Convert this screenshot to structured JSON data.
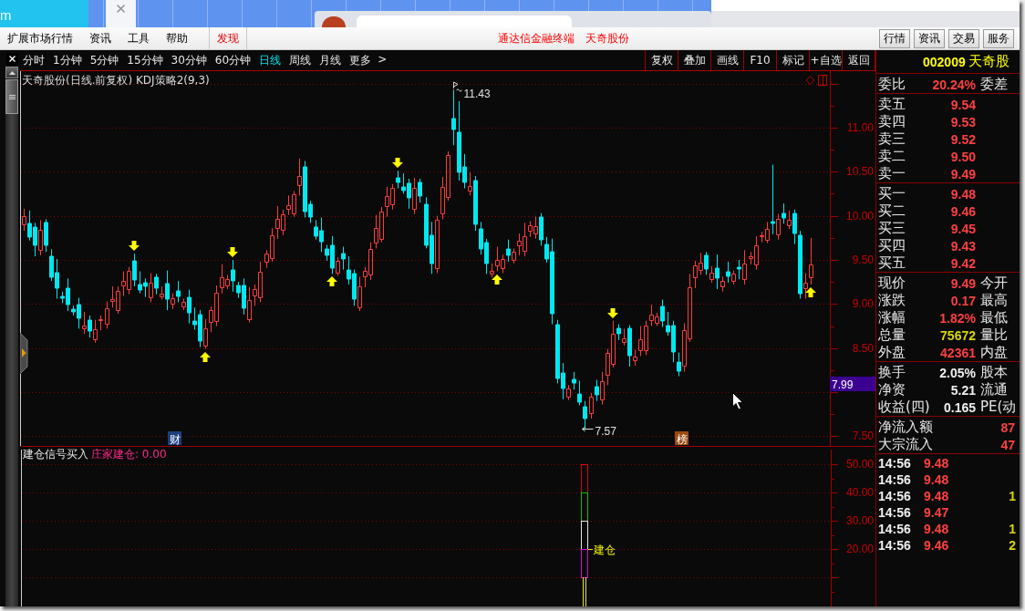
{
  "top_strip": {
    "text": "m"
  },
  "menu_bar": {
    "items": [
      {
        "label": "扩展市场行情",
        "kind": "menu"
      },
      {
        "label": "资讯",
        "kind": "menu"
      },
      {
        "label": "工具",
        "kind": "menu"
      },
      {
        "label": "帮助",
        "kind": "menu"
      },
      {
        "label": "发现",
        "kind": "feature"
      }
    ],
    "titles": [
      "通达信金融终端",
      "天奇股份"
    ],
    "buttons": [
      "行情",
      "资讯",
      "交易",
      "服务"
    ]
  },
  "toolbar": {
    "periods": [
      {
        "label": "分时",
        "selected": false
      },
      {
        "label": "1分钟",
        "selected": false
      },
      {
        "label": "5分钟",
        "selected": false
      },
      {
        "label": "15分钟",
        "selected": false
      },
      {
        "label": "30分钟",
        "selected": false
      },
      {
        "label": "60分钟",
        "selected": false
      },
      {
        "label": "日线",
        "selected": true
      },
      {
        "label": "周线",
        "selected": false
      },
      {
        "label": "月线",
        "selected": false
      }
    ],
    "more": {
      "label": "更多",
      "arrow": ">"
    },
    "tools": [
      "复权",
      "叠加",
      "画线",
      "F10",
      "标记",
      "+自选",
      "返回"
    ]
  },
  "main_chart": {
    "title": "天奇股份(日线.前复权) KDJ策略2(9,3)",
    "high_label": "11.43",
    "low_label": "7.57",
    "price_tag": "7.99",
    "badges": [
      {
        "label": "财",
        "kind": "finance"
      },
      {
        "label": "榜",
        "kind": "ranking"
      }
    ],
    "chart_data": {
      "type": "candlestick",
      "grid": true,
      "ylim": [
        7.38,
        11.64
      ],
      "yticks": [
        {
          "value": 11,
          "label": "11.00"
        },
        {
          "value": 10.5,
          "label": "10.50"
        },
        {
          "value": 10,
          "label": "10.00"
        },
        {
          "value": 9.5,
          "label": "9.50"
        },
        {
          "value": 9,
          "label": "9.00"
        },
        {
          "value": 8.5,
          "label": "8.50"
        },
        {
          "value": 7.5,
          "label": "7.50"
        }
      ],
      "categories": [
        null,
        null,
        null,
        null,
        null,
        null,
        null,
        null,
        null,
        null,
        null,
        null,
        null,
        null,
        null,
        null,
        null,
        null,
        null,
        null,
        null,
        null,
        null,
        null,
        null,
        null,
        null,
        null,
        null,
        null,
        null,
        null,
        null,
        null,
        null,
        null,
        null,
        null,
        null,
        null,
        null,
        null,
        null,
        null,
        null,
        null,
        null,
        null,
        null,
        null,
        null,
        null,
        null,
        null,
        null,
        null,
        null,
        null,
        null,
        null,
        null,
        null,
        null,
        null,
        null,
        null,
        null,
        null,
        null,
        null,
        null,
        null,
        null,
        null,
        null,
        null,
        null,
        null,
        null,
        null,
        null,
        null,
        null,
        null,
        null,
        null,
        null,
        null,
        null,
        null,
        null,
        null,
        null,
        null,
        null,
        null,
        null,
        null,
        null,
        null,
        null,
        null,
        null,
        null,
        null,
        null,
        null,
        null,
        null,
        null,
        null,
        null,
        null,
        null,
        null,
        null,
        null,
        null,
        null,
        null,
        null,
        null,
        null,
        null,
        null,
        null,
        null,
        null,
        null,
        null,
        null,
        null,
        null,
        null,
        null,
        null,
        null,
        null,
        null,
        null,
        null,
        null,
        null,
        null,
        null,
        null,
        null
      ],
      "ohlc": [
        [
          9.9,
          10.08,
          9.83,
          10.0
        ],
        [
          9.91,
          10.06,
          9.72,
          9.76
        ],
        [
          9.87,
          9.92,
          9.54,
          9.66
        ],
        [
          9.61,
          9.95,
          9.55,
          9.84
        ],
        [
          9.92,
          9.96,
          9.59,
          9.66
        ],
        [
          9.54,
          9.62,
          9.26,
          9.3
        ],
        [
          9.36,
          9.51,
          9.06,
          9.18
        ],
        [
          9.09,
          9.14,
          9.01,
          9.07
        ],
        [
          9.18,
          9.29,
          8.92,
          8.99
        ],
        [
          8.94,
          8.98,
          8.87,
          8.91
        ],
        [
          8.99,
          9.07,
          8.72,
          8.84
        ],
        [
          8.72,
          8.91,
          8.66,
          8.76
        ],
        [
          8.82,
          8.87,
          8.62,
          8.69
        ],
        [
          8.6,
          8.82,
          8.56,
          8.71
        ],
        [
          8.82,
          8.87,
          8.7,
          8.83
        ],
        [
          8.78,
          9.03,
          8.72,
          8.95
        ],
        [
          9.03,
          9.2,
          8.96,
          9.05
        ],
        [
          8.93,
          9.2,
          8.89,
          9.15
        ],
        [
          9.21,
          9.37,
          9.09,
          9.26
        ],
        [
          9.17,
          9.42,
          9.11,
          9.38
        ],
        [
          9.49,
          9.57,
          9.2,
          9.27
        ],
        [
          9.22,
          9.37,
          9.12,
          9.16
        ],
        [
          9.24,
          9.29,
          9.08,
          9.2
        ],
        [
          9.08,
          9.35,
          9.02,
          9.24
        ],
        [
          9.3,
          9.34,
          9.11,
          9.18
        ],
        [
          9.09,
          9.2,
          9.05,
          9.12
        ],
        [
          9.23,
          9.38,
          8.93,
          9.05
        ],
        [
          9.0,
          9.12,
          8.94,
          9.07
        ],
        [
          9.15,
          9.26,
          9.02,
          9.09
        ],
        [
          8.97,
          9.06,
          8.93,
          9.02
        ],
        [
          9.08,
          9.16,
          8.78,
          8.9
        ],
        [
          8.81,
          8.96,
          8.71,
          8.77
        ],
        [
          8.88,
          8.93,
          8.51,
          8.58
        ],
        [
          8.53,
          8.83,
          8.49,
          8.72
        ],
        [
          8.8,
          8.97,
          8.68,
          8.93
        ],
        [
          8.81,
          9.21,
          8.75,
          9.13
        ],
        [
          9.19,
          9.45,
          9.12,
          9.3
        ],
        [
          9.21,
          9.33,
          9.17,
          9.28
        ],
        [
          9.39,
          9.5,
          9.14,
          9.26
        ],
        [
          9.21,
          9.25,
          9.07,
          9.13
        ],
        [
          9.21,
          9.29,
          8.88,
          8.95
        ],
        [
          8.83,
          9.19,
          8.79,
          9.04
        ],
        [
          9.1,
          9.22,
          8.98,
          9.17
        ],
        [
          9.08,
          9.48,
          9.02,
          9.37
        ],
        [
          9.48,
          9.61,
          9.41,
          9.57
        ],
        [
          9.52,
          9.86,
          9.48,
          9.78
        ],
        [
          9.86,
          10.11,
          9.74,
          9.96
        ],
        [
          9.84,
          10.07,
          9.78,
          10.02
        ],
        [
          10.08,
          10.23,
          10.01,
          10.12
        ],
        [
          10.03,
          10.28,
          9.99,
          10.24
        ],
        [
          10.35,
          10.65,
          10.23,
          10.45
        ],
        [
          10.55,
          10.62,
          9.98,
          10.05
        ],
        [
          10.13,
          10.17,
          9.92,
          9.99
        ],
        [
          9.87,
          9.95,
          9.73,
          9.77
        ],
        [
          9.83,
          9.98,
          9.59,
          9.71
        ],
        [
          9.62,
          9.67,
          9.49,
          9.55
        ],
        [
          9.66,
          9.77,
          9.34,
          9.41
        ],
        [
          9.36,
          9.53,
          9.32,
          9.49
        ],
        [
          9.57,
          9.65,
          9.39,
          9.51
        ],
        [
          9.39,
          9.54,
          9.22,
          9.28
        ],
        [
          9.34,
          9.39,
          8.98,
          9.05
        ],
        [
          8.96,
          9.31,
          8.92,
          9.2
        ],
        [
          9.31,
          9.42,
          9.19,
          9.38
        ],
        [
          9.33,
          9.7,
          9.27,
          9.62
        ],
        [
          9.7,
          10.01,
          9.63,
          9.86
        ],
        [
          9.74,
          10.1,
          9.7,
          10.05
        ],
        [
          10.11,
          10.33,
          9.99,
          10.22
        ],
        [
          10.13,
          10.36,
          10.07,
          10.32
        ],
        [
          10.43,
          10.51,
          10.31,
          10.38
        ],
        [
          10.33,
          10.48,
          10.25,
          10.29
        ],
        [
          10.37,
          10.42,
          10.08,
          10.2
        ],
        [
          10.08,
          10.43,
          10.02,
          10.32
        ],
        [
          10.38,
          10.42,
          10.15,
          10.22
        ],
        [
          10.13,
          10.21,
          9.63,
          9.67
        ],
        [
          9.78,
          9.93,
          9.34,
          9.46
        ],
        [
          9.41,
          10.0,
          9.35,
          9.95
        ],
        [
          10.03,
          10.44,
          9.96,
          10.33
        ],
        [
          10.21,
          10.73,
          10.17,
          10.69
        ],
        [
          11.1,
          11.43,
          10.8,
          10.98
        ],
        [
          10.95,
          11.3,
          10.4,
          10.49
        ],
        [
          10.55,
          10.7,
          10.31,
          10.38
        ],
        [
          10.29,
          10.49,
          10.23,
          10.34
        ],
        [
          10.4,
          10.45,
          9.83,
          9.9
        ],
        [
          9.85,
          9.93,
          9.56,
          9.62
        ],
        [
          9.7,
          9.74,
          9.34,
          9.46
        ],
        [
          9.34,
          9.46,
          9.3,
          9.38
        ],
        [
          9.44,
          9.65,
          9.37,
          9.5
        ],
        [
          9.41,
          9.56,
          9.35,
          9.51
        ],
        [
          9.62,
          9.73,
          9.48,
          9.55
        ],
        [
          9.5,
          9.63,
          9.46,
          9.59
        ],
        [
          9.67,
          9.8,
          9.55,
          9.72
        ],
        [
          9.6,
          9.92,
          9.54,
          9.77
        ],
        [
          9.83,
          9.94,
          9.76,
          9.89
        ],
        [
          9.8,
          9.99,
          9.74,
          9.88
        ],
        [
          9.99,
          10.03,
          9.66,
          9.73
        ],
        [
          9.68,
          9.76,
          9.47,
          9.51
        ],
        [
          9.59,
          9.74,
          8.77,
          8.89
        ],
        [
          8.77,
          8.82,
          8.1,
          8.16
        ],
        [
          8.22,
          8.33,
          7.92,
          8.04
        ],
        [
          7.95,
          8.08,
          7.91,
          8.04
        ],
        [
          8.15,
          8.23,
          8.03,
          8.1
        ],
        [
          7.98,
          8.13,
          7.85,
          7.89
        ],
        [
          7.83,
          7.9,
          7.57,
          7.7
        ],
        [
          7.76,
          7.99,
          7.7,
          7.95
        ],
        [
          8.06,
          8.14,
          7.9,
          7.97
        ],
        [
          7.92,
          8.23,
          7.86,
          8.12
        ],
        [
          8.2,
          8.49,
          8.08,
          8.44
        ],
        [
          8.32,
          8.81,
          8.28,
          8.66
        ],
        [
          8.72,
          8.77,
          8.59,
          8.66
        ],
        [
          8.57,
          8.72,
          8.53,
          8.61
        ],
        [
          8.72,
          8.76,
          8.29,
          8.41
        ],
        [
          8.36,
          8.48,
          8.3,
          8.4
        ],
        [
          8.48,
          8.75,
          8.41,
          8.6
        ],
        [
          8.48,
          8.81,
          8.42,
          8.76
        ],
        [
          8.82,
          8.99,
          8.75,
          8.88
        ],
        [
          8.79,
          8.9,
          8.75,
          8.86
        ],
        [
          8.97,
          9.05,
          8.74,
          8.81
        ],
        [
          8.76,
          8.91,
          8.64,
          8.68
        ],
        [
          8.76,
          8.81,
          8.34,
          8.46
        ],
        [
          8.34,
          8.45,
          8.18,
          8.24
        ],
        [
          8.3,
          8.78,
          8.23,
          8.7
        ],
        [
          8.61,
          9.34,
          8.57,
          9.19
        ],
        [
          9.3,
          9.49,
          9.18,
          9.44
        ],
        [
          9.39,
          9.58,
          9.33,
          9.47
        ],
        [
          9.55,
          9.59,
          9.33,
          9.4
        ],
        [
          9.28,
          9.43,
          9.24,
          9.35
        ],
        [
          9.41,
          9.56,
          9.17,
          9.29
        ],
        [
          9.2,
          9.31,
          9.14,
          9.26
        ],
        [
          9.37,
          9.48,
          9.24,
          9.31
        ],
        [
          9.26,
          9.38,
          9.22,
          9.34
        ],
        [
          9.42,
          9.5,
          9.28,
          9.4
        ],
        [
          9.28,
          9.61,
          9.22,
          9.46
        ],
        [
          9.52,
          9.59,
          9.45,
          9.54
        ],
        [
          9.45,
          9.77,
          9.39,
          9.66
        ],
        [
          9.77,
          9.82,
          9.7,
          9.78
        ],
        [
          9.73,
          9.93,
          9.69,
          9.85
        ],
        [
          9.93,
          10.58,
          9.79,
          9.91
        ],
        [
          9.79,
          10.02,
          9.73,
          9.97
        ],
        [
          10.03,
          10.14,
          9.91,
          9.98
        ],
        [
          9.89,
          10.06,
          9.85,
          9.95
        ],
        [
          10.03,
          10.07,
          9.68,
          9.8
        ],
        [
          9.78,
          9.83,
          9.06,
          9.12
        ],
        [
          9.18,
          9.35,
          9.06,
          9.24
        ],
        [
          9.3,
          9.75,
          9.22,
          9.45
        ],
        null,
        null,
        null
      ]
    }
  },
  "indicator_panel": {
    "name": "建仓信号买入",
    "legend": "庄家建仓: 0.00",
    "y_axis": [
      "50.00",
      "40.00",
      "30.00",
      "20.00"
    ],
    "signal_label": "建仓"
  },
  "quote_panel": {
    "code": "002009",
    "name": "天奇股",
    "sections": [
      {
        "kind": "quote",
        "rows": [
          {
            "label": "委比",
            "value": "20.24%",
            "label2": "委差",
            "color": "#ff4040"
          }
        ]
      },
      {
        "kind": "quote",
        "rows": [
          {
            "label": "卖五",
            "value": "9.54",
            "color": "#ff4040"
          },
          {
            "label": "卖四",
            "value": "9.53",
            "color": "#ff4040"
          },
          {
            "label": "卖三",
            "value": "9.52",
            "color": "#ff4040"
          },
          {
            "label": "卖二",
            "value": "9.50",
            "color": "#ff4040"
          },
          {
            "label": "卖一",
            "value": "9.49",
            "color": "#ff4040"
          }
        ]
      },
      {
        "kind": "quote",
        "rows": [
          {
            "label": "买一",
            "value": "9.48",
            "color": "#ff4040"
          },
          {
            "label": "买二",
            "value": "9.46",
            "color": "#ff4040"
          },
          {
            "label": "买三",
            "value": "9.45",
            "color": "#ff4040"
          },
          {
            "label": "买四",
            "value": "9.43",
            "color": "#ff4040"
          },
          {
            "label": "买五",
            "value": "9.42",
            "color": "#ff4040"
          }
        ]
      },
      {
        "kind": "quote",
        "rows": [
          {
            "label": "现价",
            "value": "9.49",
            "label2": "今开",
            "color": "#ff4040"
          },
          {
            "label": "涨跌",
            "value": "0.17",
            "label2": "最高",
            "color": "#ff4040"
          },
          {
            "label": "涨幅",
            "value": "1.82%",
            "label2": "最低",
            "color": "#ff4040"
          },
          {
            "label": "总量",
            "value": "75672",
            "label2": "量比",
            "color": "#d8d800"
          },
          {
            "label": "外盘",
            "value": "42361",
            "label2": "内盘",
            "color": "#ff4040"
          }
        ]
      },
      {
        "kind": "quote",
        "rows": [
          {
            "label": "换手",
            "value": "2.05%",
            "label2": "股本",
            "color": "#f0f0f0"
          },
          {
            "label": "净资",
            "value": "5.21",
            "label2": "流通",
            "color": "#f0f0f0"
          },
          {
            "label": "收益(四)",
            "value": "0.165",
            "label2": "PE(动",
            "color": "#f0f0f0"
          }
        ]
      },
      {
        "kind": "flow",
        "rows": [
          {
            "label": "净流入额",
            "value": "87",
            "color": "#ff4040"
          },
          {
            "label": "大宗流入",
            "value": "47",
            "color": "#ff4040"
          }
        ]
      }
    ],
    "ticks": [
      {
        "time": "14:56",
        "price": "9.48"
      },
      {
        "time": "14:56",
        "price": "9.48"
      },
      {
        "time": "14:56",
        "price": "9.48",
        "volume": "1"
      },
      {
        "time": "14:56",
        "price": "9.47"
      },
      {
        "time": "14:56",
        "price": "9.48",
        "volume": "1"
      },
      {
        "time": "14:56",
        "price": "9.46",
        "volume": "2"
      }
    ]
  }
}
